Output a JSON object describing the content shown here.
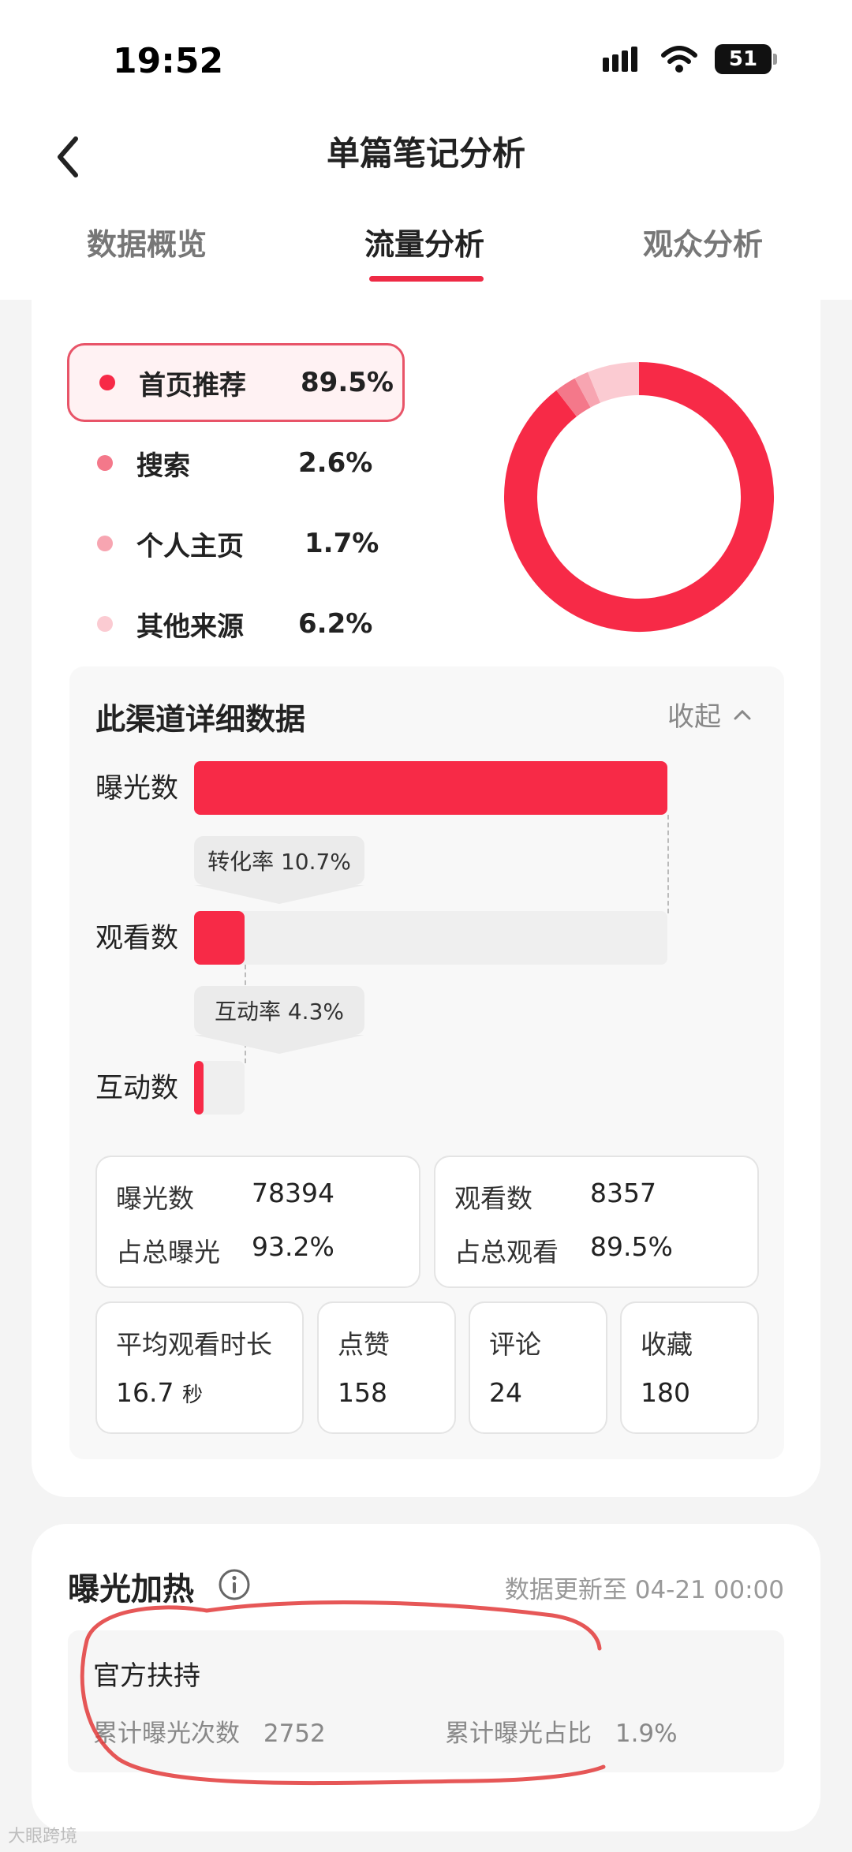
{
  "status_bar": {
    "time": "19:52",
    "battery": "51"
  },
  "header": {
    "title": "单篇笔记分析",
    "tabs": [
      {
        "label": "数据概览",
        "active": false
      },
      {
        "label": "流量分析",
        "active": true
      },
      {
        "label": "观众分析",
        "active": false
      }
    ]
  },
  "traffic_sources": [
    {
      "label": "首页推荐",
      "value": "89.5%",
      "color": "#f72a47",
      "selected": true
    },
    {
      "label": "搜索",
      "value": "2.6%",
      "color": "#f4788a",
      "selected": false
    },
    {
      "label": "个人主页",
      "value": "1.7%",
      "color": "#f7a5b1",
      "selected": false
    },
    {
      "label": "其他来源",
      "value": "6.2%",
      "color": "#fbcbd2",
      "selected": false
    }
  ],
  "chart_data": {
    "type": "pie",
    "categories": [
      "首页推荐",
      "搜索",
      "个人主页",
      "其他来源"
    ],
    "values": [
      89.5,
      2.6,
      1.7,
      6.2
    ],
    "colors": [
      "#f72a47",
      "#f4788a",
      "#f7a5b1",
      "#fbcbd2"
    ]
  },
  "detail": {
    "title": "此渠道详细数据",
    "collapse_label": "收起",
    "funnel": [
      {
        "label": "曝光数",
        "fill": 1.0
      },
      {
        "label": "观看数",
        "fill": 0.107
      },
      {
        "label": "互动数",
        "fill": 0.02
      }
    ],
    "conversion_rate": "转化率 10.7%",
    "interaction_rate": "互动率 4.3%",
    "stats": {
      "exposure_label": "曝光数",
      "exposure_value": "78394",
      "exposure_share_label": "占总曝光",
      "exposure_share_value": "93.2%",
      "views_label": "观看数",
      "views_value": "8357",
      "views_share_label": "占总观看",
      "views_share_value": "89.5%",
      "avg_time_label": "平均观看时长",
      "avg_time_value": "16.7",
      "avg_time_unit": "秒",
      "likes_label": "点赞",
      "likes_value": "158",
      "comments_label": "评论",
      "comments_value": "24",
      "favorites_label": "收藏",
      "favorites_value": "180"
    }
  },
  "boost": {
    "title": "曝光加热",
    "update_note": "数据更新至 04-21 00:00",
    "support_title": "官方扶持",
    "total_exposure_label": "累计曝光次数",
    "total_exposure_value": "2752",
    "exposure_share_label": "累计曝光占比",
    "exposure_share_value": "1.9%"
  },
  "watermark": "大眼跨境"
}
